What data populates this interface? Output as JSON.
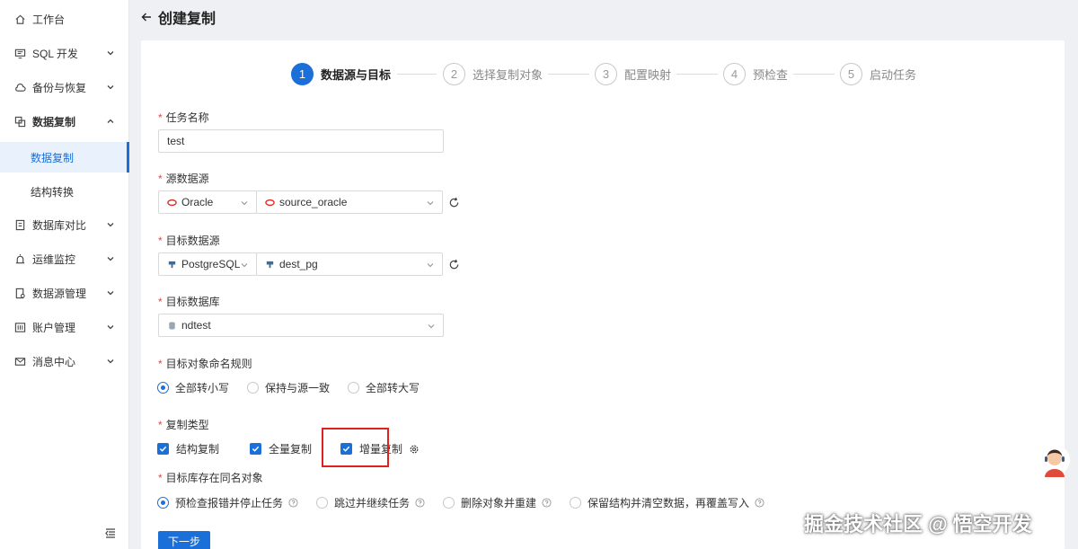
{
  "sidebar": {
    "items": [
      {
        "label": "工作台",
        "icon": "home-icon"
      },
      {
        "label": "SQL 开发",
        "icon": "monitor-icon"
      },
      {
        "label": "备份与恢复",
        "icon": "cloud-backup-icon"
      },
      {
        "label": "数据复制",
        "icon": "copy-icon"
      },
      {
        "label": "数据库对比",
        "icon": "compare-icon"
      },
      {
        "label": "运维监控",
        "icon": "alarm-icon"
      },
      {
        "label": "数据源管理",
        "icon": "datasource-icon"
      },
      {
        "label": "账户管理",
        "icon": "account-icon"
      },
      {
        "label": "消息中心",
        "icon": "mail-icon"
      }
    ],
    "sub_items": [
      {
        "label": "数据复制",
        "active": true
      },
      {
        "label": "结构转换",
        "active": false
      }
    ]
  },
  "header": {
    "title": "创建复制"
  },
  "steps": [
    {
      "num": "1",
      "label": "数据源与目标",
      "active": true
    },
    {
      "num": "2",
      "label": "选择复制对象",
      "active": false
    },
    {
      "num": "3",
      "label": "配置映射",
      "active": false
    },
    {
      "num": "4",
      "label": "预检查",
      "active": false
    },
    {
      "num": "5",
      "label": "启动任务",
      "active": false
    }
  ],
  "form": {
    "required_mark": "*",
    "task_name": {
      "label": "任务名称",
      "value": "test"
    },
    "source": {
      "label": "源数据源",
      "type": "Oracle",
      "name": "source_oracle"
    },
    "target": {
      "label": "目标数据源",
      "type": "PostgreSQL",
      "name": "dest_pg"
    },
    "target_db": {
      "label": "目标数据库",
      "value": "ndtest"
    },
    "naming_rule": {
      "label": "目标对象命名规则",
      "options": [
        "全部转小写",
        "保持与源一致",
        "全部转大写"
      ],
      "selected": 0
    },
    "copy_type": {
      "label": "复制类型",
      "options": [
        "结构复制",
        "全量复制",
        "增量复制"
      ],
      "checked": [
        true,
        true,
        true
      ]
    },
    "same_name": {
      "label": "目标库存在同名对象",
      "options": [
        "预检查报错并停止任务",
        "跳过并继续任务",
        "删除对象并重建",
        "保留结构并清空数据，再覆盖写入"
      ],
      "selected": 0
    }
  },
  "buttons": {
    "next": "下一步"
  },
  "colors": {
    "primary": "#1a6fd8",
    "highlight": "#e0221e",
    "oracle": "#e0221e"
  },
  "watermark": "掘金技术社区 @ 悟空开发"
}
